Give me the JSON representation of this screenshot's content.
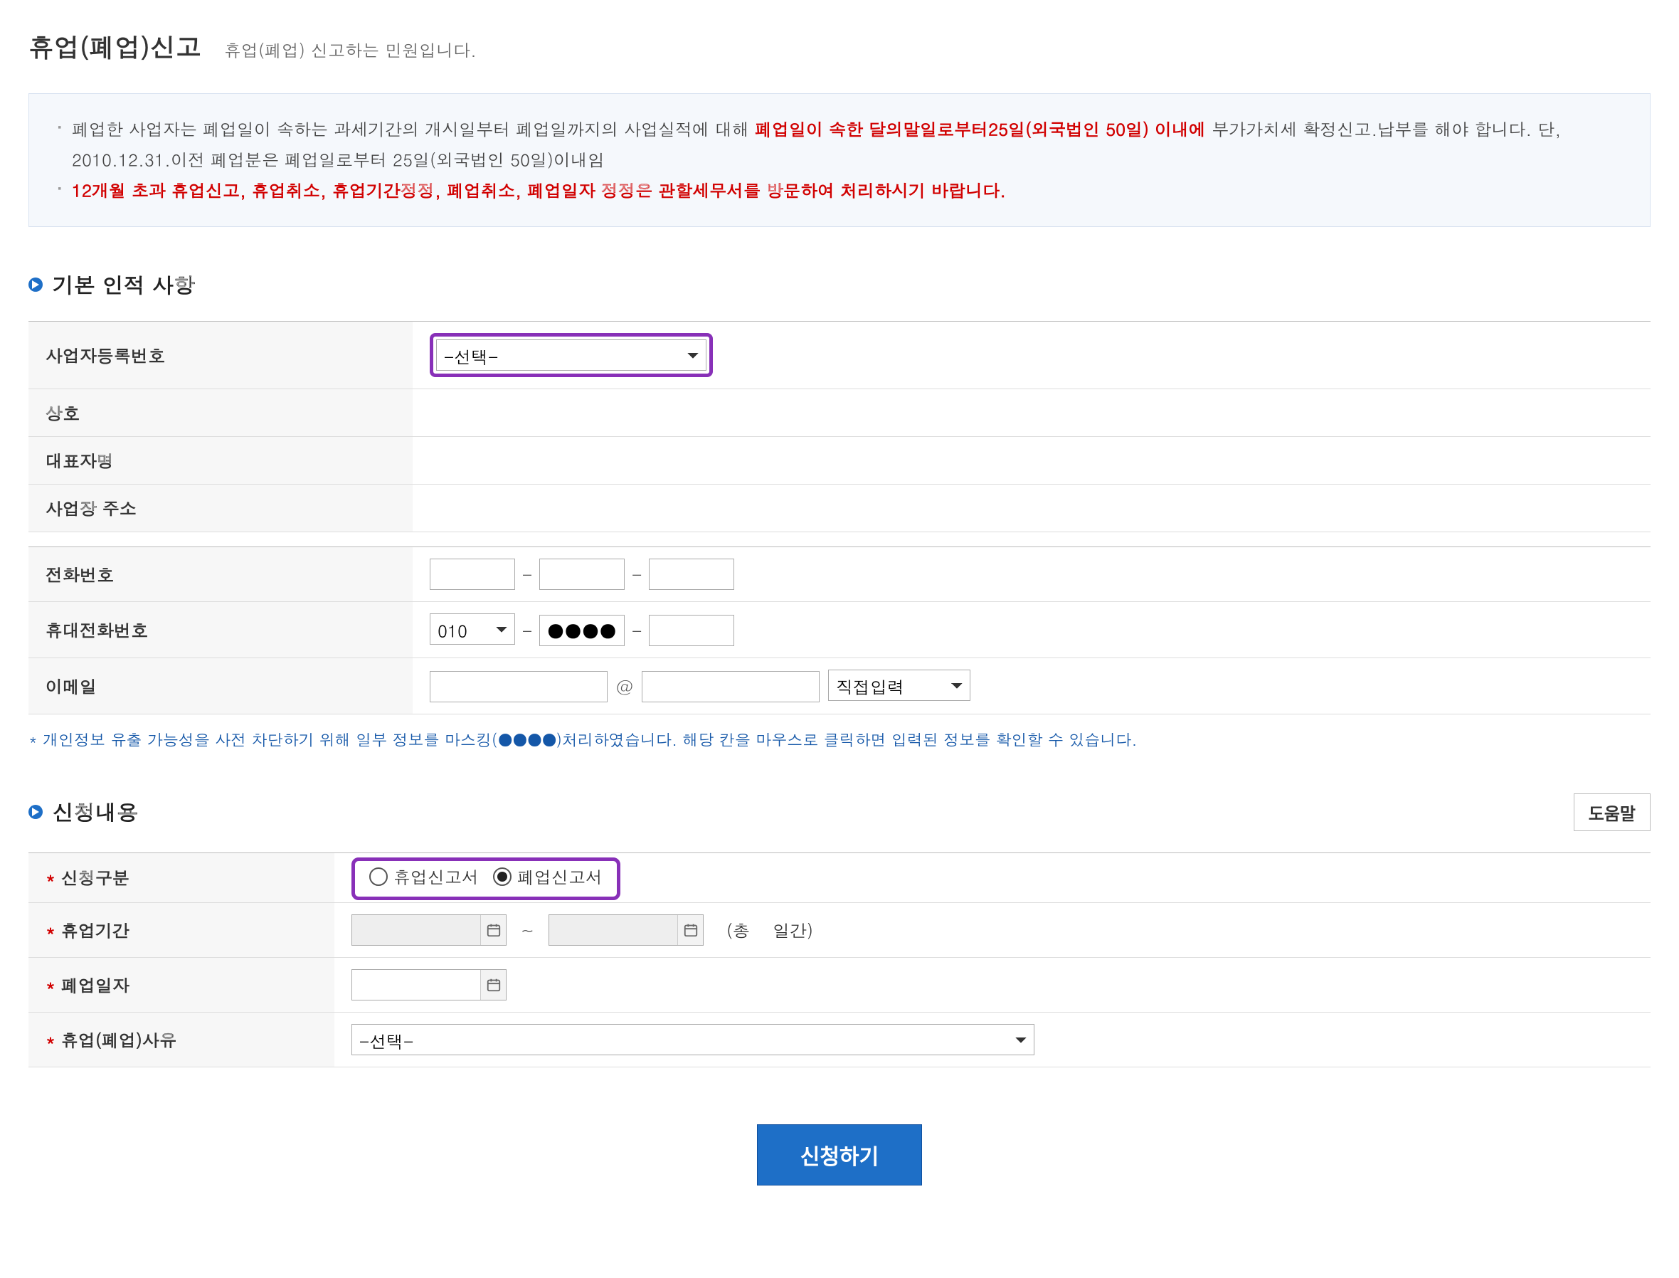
{
  "header": {
    "title": "휴업(폐업)신고",
    "subtitle": "휴업(폐업) 신고하는 민원입니다."
  },
  "notice": {
    "line1_a": "폐업한 사업자는 폐업일이 속하는 과세기간의 개시일부터 폐업일까지의 사업실적에 대해 ",
    "line1_red": "폐업일이 속한 달의말일로부터25일(외국법인 50일) 이내에",
    "line1_b": " 부가가치세 확정신고.납부를 해야 합니다. 단, 2010.12.31.이전 폐업분은 폐업일로부터 25일(외국법인 50일)이내임",
    "line2_red": "12개월 초과 휴업신고, 휴업취소, 휴업기간정정, 폐업취소, 폐업일자 정정은 관할세무서를 방문하여 처리하시기 바랍니다."
  },
  "section1": {
    "title": "기본 인적 사항",
    "labels": {
      "biz_no": "사업자등록번호",
      "company": "상호",
      "rep": "대표자명",
      "addr": "사업장 주소",
      "tel": "전화번호",
      "mobile": "휴대전화번호",
      "email": "이메일"
    },
    "biz_no_select": "-선택-",
    "mobile_prefix": "010",
    "mobile_mid": "●●●●",
    "email_domain_select": "직접입력",
    "dash": "-",
    "at": "@"
  },
  "info_note": "* 개인정보 유출 가능성을 사전 차단하기 위해 일부 정보를 마스킹(●●●●)처리하였습니다. 해당 칸을 마우스로 클릭하면 입력된 정보를 확인할 수 있습니다.",
  "section2": {
    "title": "신청내용",
    "help_btn": "도움말",
    "labels": {
      "type": "신청구분",
      "period": "휴업기간",
      "close_date": "폐업일자",
      "reason": "휴업(폐업)사유"
    },
    "radio_suspend": "휴업신고서",
    "radio_close": "폐업신고서",
    "radio_selected": "close",
    "tilde": "~",
    "days_prefix": "(총",
    "days_suffix": "일간)",
    "reason_select": "-선택-"
  },
  "submit_label": "신청하기"
}
